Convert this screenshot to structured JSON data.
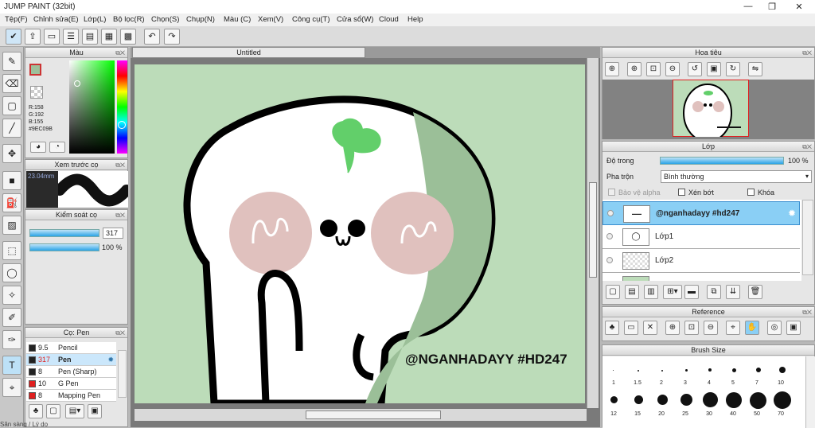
{
  "app": {
    "title": "JUMP PAINT (32bit)",
    "win_min": "—",
    "win_max": "❐",
    "win_close": "✕"
  },
  "menu": [
    "Tệp(F)",
    "Chỉnh sửa(E)",
    "Lớp(L)",
    "Bộ lọc(R)",
    "Chọn(S)",
    "Chụp(N)",
    "Màu (C)",
    "Xem(V)",
    "Công cụ(T)",
    "Cửa sổ(W)",
    "Cloud",
    "Help"
  ],
  "color_panel": {
    "title": "Màu",
    "r": "R:158",
    "g": "G:192",
    "b": "B:155",
    "hex": "#9EC09B",
    "fg_color": "#9EC09B"
  },
  "preview_panel": {
    "title": "Xem trước cọ",
    "size": "23.04mm"
  },
  "brush_control": {
    "title": "Kiểm soát cọ",
    "size_value": "317",
    "opacity_value": "100 %"
  },
  "brush_panel": {
    "title": "Cọ: Pen",
    "items": [
      {
        "size": "9.5",
        "name": "Pencil",
        "color": "#222222"
      },
      {
        "size": "317",
        "name": "Pen",
        "color": "#222222"
      },
      {
        "size": "8",
        "name": "Pen (Sharp)",
        "color": "#222222"
      },
      {
        "size": "10",
        "name": "G Pen",
        "color": "#e02020"
      },
      {
        "size": "8",
        "name": "Mapping Pen",
        "color": "#e02020"
      }
    ]
  },
  "canvas": {
    "tab": "Untitled",
    "signature": "@NGANHADAYY #HD247",
    "bg": "#bcdcb9"
  },
  "navigator": {
    "title": "Hoa tiêu"
  },
  "layer_panel": {
    "title": "Lớp",
    "opacity_label": "Độ trong",
    "opacity_value": "100 %",
    "blend_label": "Pha trộn",
    "blend_value": "Bình thường",
    "protect_alpha": "Bảo vệ alpha",
    "clipping": "Xén bớt",
    "lock": "Khóa",
    "layers": [
      {
        "name": "@nganhadayy #hd247",
        "selected": true
      },
      {
        "name": "Lớp1",
        "selected": false
      },
      {
        "name": "Lớp2",
        "selected": false
      }
    ]
  },
  "reference_panel": {
    "title": "Reference"
  },
  "brush_size_panel": {
    "title": "Brush Size",
    "row1": [
      "1",
      "1.5",
      "2",
      "3",
      "4",
      "5",
      "7",
      "10"
    ],
    "row2": [
      "12",
      "15",
      "20",
      "25",
      "30",
      "40",
      "50",
      "70"
    ]
  },
  "status": {
    "text": "Sẵn sàng / Lý do"
  }
}
